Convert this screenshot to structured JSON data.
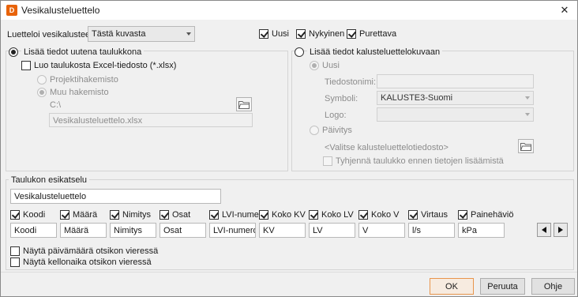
{
  "window": {
    "title": "Vesikalusteluettelo",
    "app_icon_letter": "D"
  },
  "top": {
    "list_label": "Luetteloi vesikalusteet",
    "list_value": "Tästä kuvasta",
    "filters": [
      {
        "label": "Uusi",
        "checked": true
      },
      {
        "label": "Nykyinen",
        "checked": true
      },
      {
        "label": "Purettava",
        "checked": true
      }
    ]
  },
  "left": {
    "radio_new_table": "Lisää tiedot uutena taulukkona",
    "excel_checkbox": "Luo taulukosta Excel-tiedosto (*.xlsx)",
    "radio_project": "Projektihakemisto",
    "radio_other": "Muu hakemisto",
    "path": "C:\\",
    "filename": "Vesikalusteluettelo.xlsx"
  },
  "right": {
    "radio_add_drawing": "Lisää tiedot kalusteluettelokuvaan",
    "radio_uusi": "Uusi",
    "filename_label": "Tiedostonimi:",
    "filename_value": "",
    "symbol_label": "Symboli:",
    "symbol_value": "KALUSTE3-Suomi",
    "logo_label": "Logo:",
    "logo_value": "",
    "radio_update": "Päivitys",
    "select_file": "<Valitse kalusteluettelotiedosto>",
    "clear_table": "Tyhjennä taulukko ennen tietojen lisäämistä"
  },
  "preview": {
    "title": "Taulukon esikatselu",
    "table_title": "Vesikalusteluettelo",
    "columns": [
      {
        "label": "Koodi",
        "value": "Koodi"
      },
      {
        "label": "Määrä",
        "value": "Määrä"
      },
      {
        "label": "Nimitys",
        "value": "Nimitys"
      },
      {
        "label": "Osat",
        "value": "Osat"
      },
      {
        "label": "LVI-numero",
        "value": "LVI-numero"
      },
      {
        "label": "Koko KV",
        "value": "KV"
      },
      {
        "label": "Koko LV",
        "value": "LV"
      },
      {
        "label": "Koko V",
        "value": "V"
      },
      {
        "label": "Virtaus",
        "value": "l/s"
      },
      {
        "label": "Painehäviö",
        "value": "kPa"
      }
    ],
    "show_date": "Näytä päivämäärä otsikon vieressä",
    "show_time": "Näytä kellonaika otsikon vieressä"
  },
  "buttons": {
    "ok": "OK",
    "cancel": "Peruuta",
    "help": "Ohje"
  }
}
